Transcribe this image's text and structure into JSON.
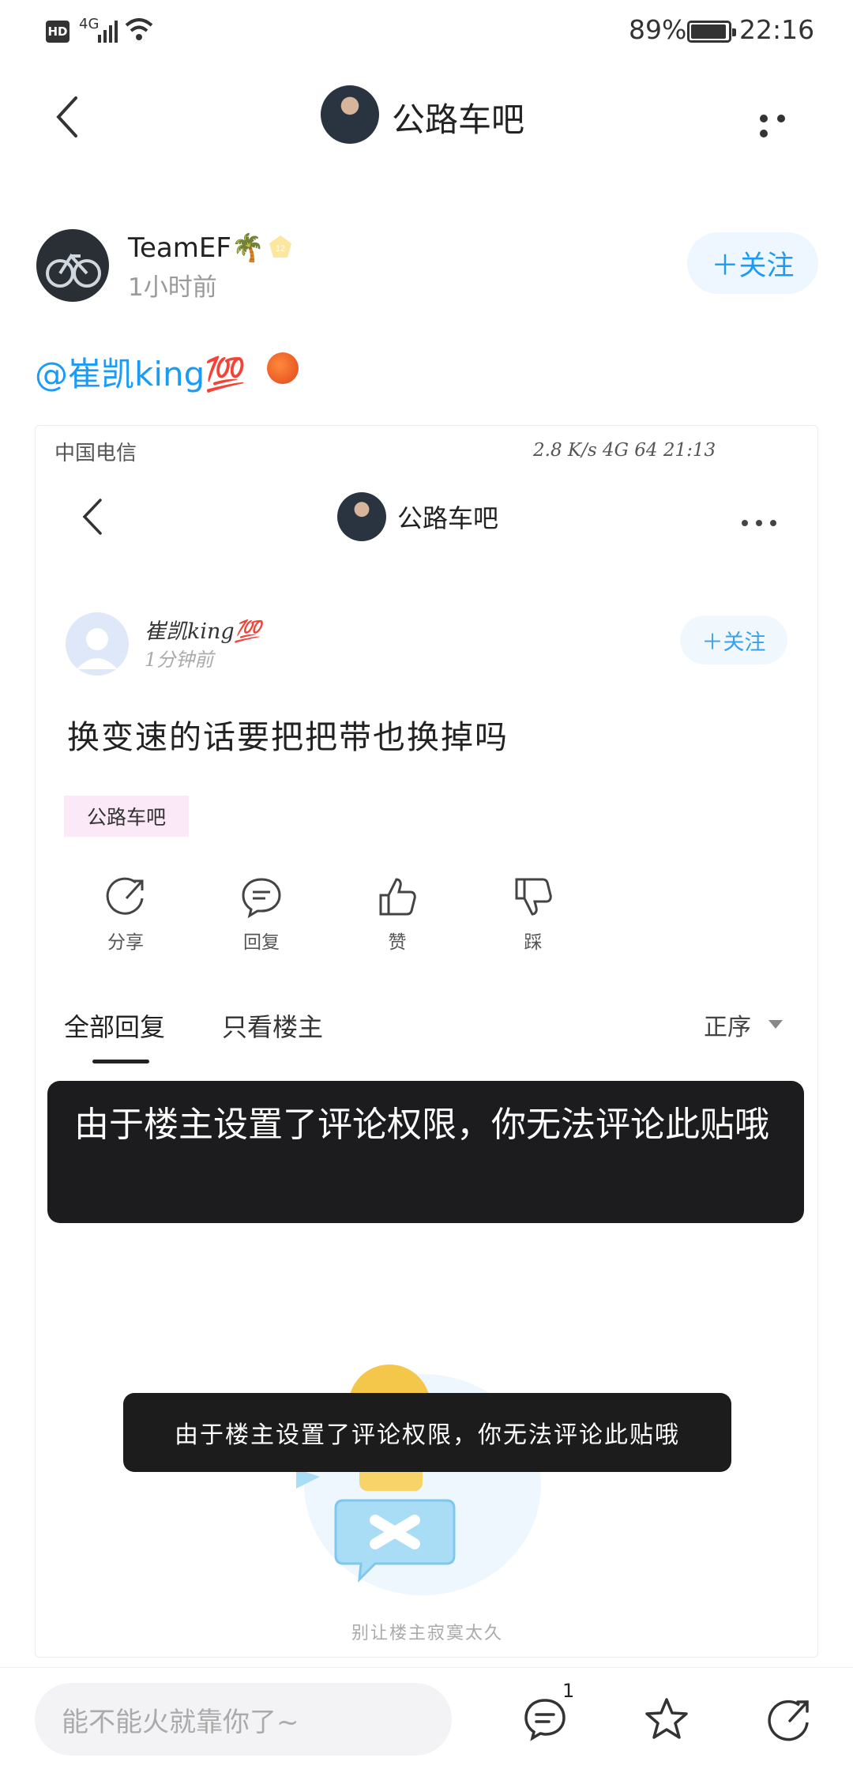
{
  "status_bar": {
    "hd": "HD",
    "network": "4G",
    "battery_percent": "89%",
    "time": "22:16"
  },
  "nav": {
    "title": "公路车吧",
    "back_icon": "chevron-left-icon",
    "more_icon": "more-dots-icon"
  },
  "author": {
    "name": "TeamEF🌴",
    "level": "12",
    "time": "1小时前",
    "follow_label": "＋关注"
  },
  "post": {
    "mention": "@崔凯king💯"
  },
  "screenshot": {
    "carrier": "中国电信",
    "status_right": "2.8 K/s    4G    64  21:13",
    "title": "公路车吧",
    "user_name": "崔凯king💯",
    "user_time": "1分钟前",
    "follow_label": "＋关注",
    "post_text": "换变速的话要把把带也换掉吗",
    "tag": "公路车吧",
    "actions": [
      {
        "label": "分享",
        "icon": "share-icon"
      },
      {
        "label": "回复",
        "icon": "comment-icon"
      },
      {
        "label": "赞",
        "icon": "thumbs-up-icon"
      },
      {
        "label": "踩",
        "icon": "thumbs-down-icon"
      }
    ],
    "tab_all": "全部回复",
    "tab_op": "只看楼主",
    "sort": "正序",
    "toast": "由于楼主设置了评论权限，你无法评论此贴哦",
    "empty_text": "别让楼主寂寞太久"
  },
  "toast": {
    "text": "由于楼主设置了评论权限，你无法评论此贴哦"
  },
  "bottom": {
    "input_placeholder": "能不能火就靠你了~",
    "comment_count": "1"
  },
  "colors": {
    "accent": "#1a9bf5",
    "toast_bg": "#1c1c1e"
  }
}
